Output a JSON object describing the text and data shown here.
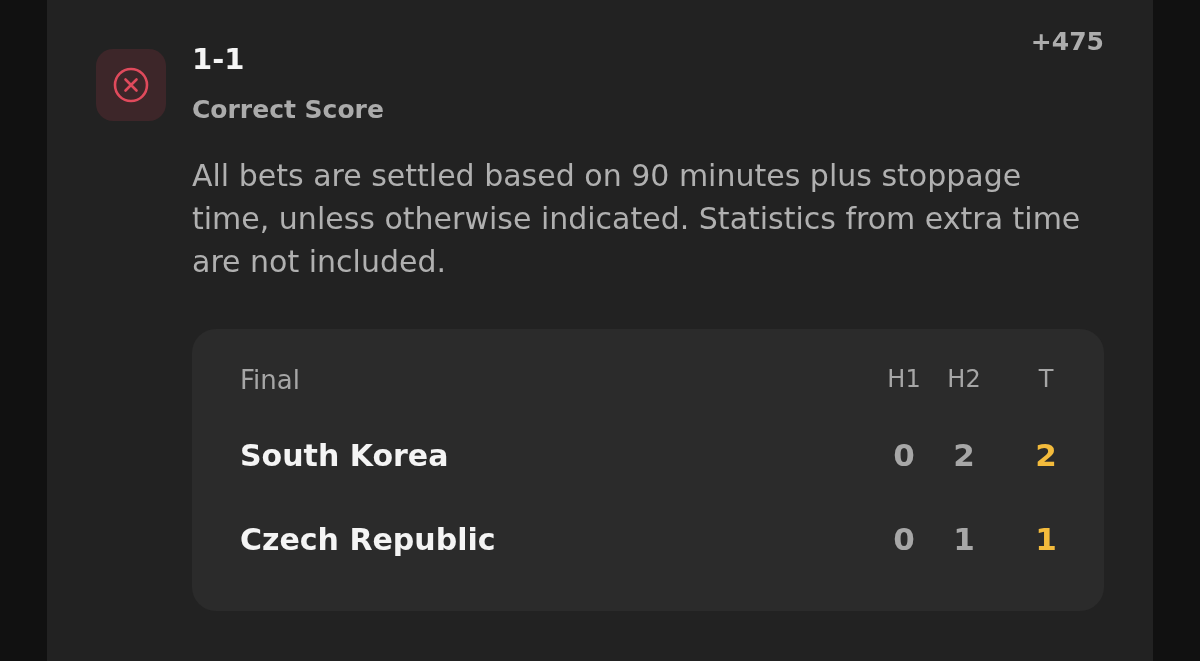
{
  "bet": {
    "lost": true,
    "selection": "1-1",
    "market": "Correct Score",
    "odds": "+475",
    "rules": "All bets are settled based on 90 minutes plus stoppage time, unless otherwise indicated. Statistics from extra time are not included."
  },
  "scoreboard": {
    "status": "Final",
    "columns": [
      {
        "label": "H1",
        "highlighted": false
      },
      {
        "label": "H2",
        "highlighted": false
      },
      {
        "label": "T",
        "highlighted": true
      }
    ],
    "rows": [
      {
        "team": "South Korea",
        "scores": [
          "0",
          "2",
          "2"
        ]
      },
      {
        "team": "Czech Republic",
        "scores": [
          "0",
          "1",
          "1"
        ]
      }
    ]
  }
}
